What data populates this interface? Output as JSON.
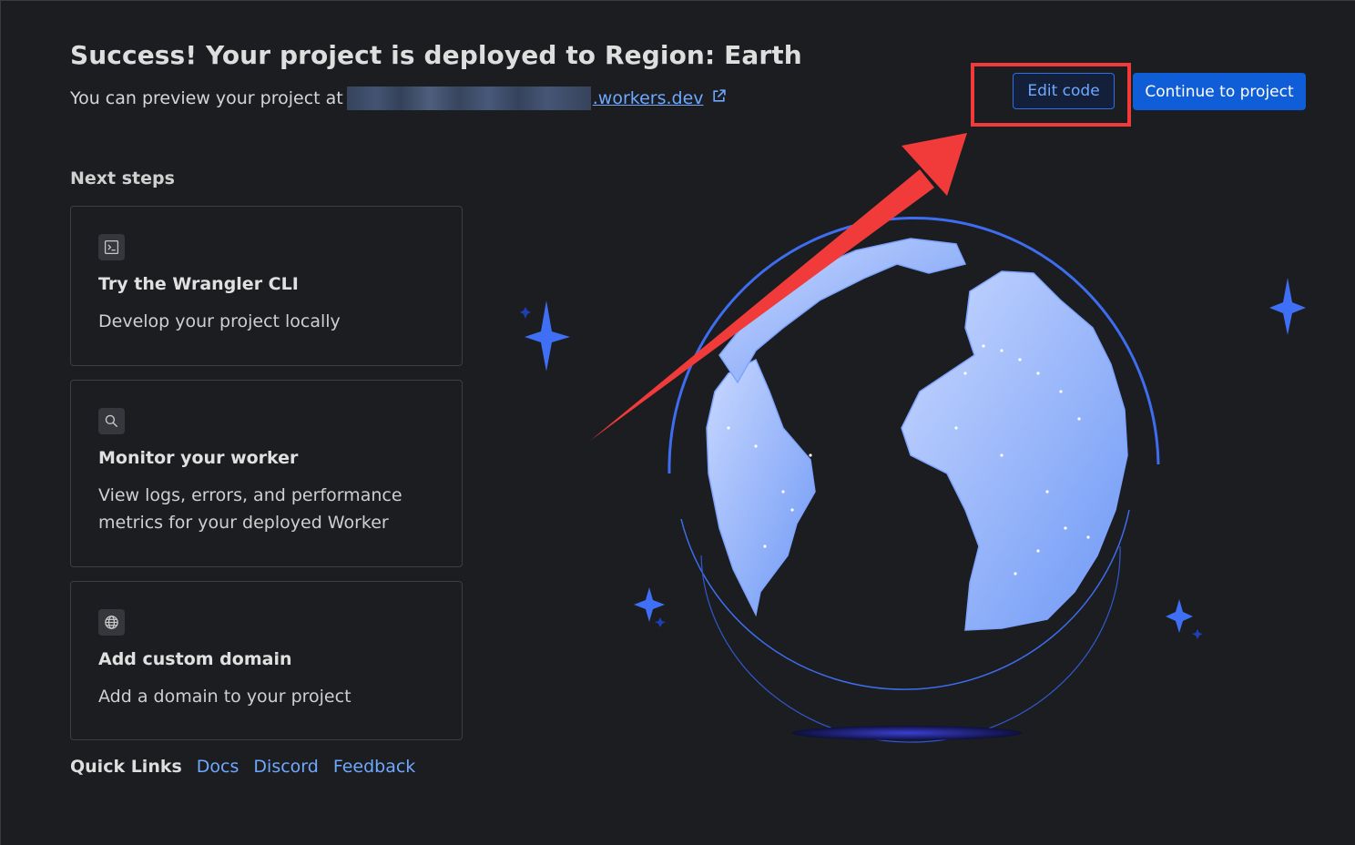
{
  "header": {
    "title": "Success! Your project is deployed to Region: Earth",
    "preview_prefix": "You can preview your project at",
    "preview_link_suffix": ".workers.dev",
    "external_link_icon": "external-link-icon"
  },
  "actions": {
    "edit_code": "Edit code",
    "continue": "Continue to project"
  },
  "next_steps": {
    "heading": "Next steps",
    "cards": [
      {
        "icon": "terminal-icon",
        "title": "Try the Wrangler CLI",
        "description": "Develop your project locally"
      },
      {
        "icon": "search-icon",
        "title": "Monitor your worker",
        "description": "View logs, errors, and performance metrics for your deployed Worker"
      },
      {
        "icon": "globe-icon",
        "title": "Add custom domain",
        "description": "Add a domain to your project"
      }
    ]
  },
  "quick_links": {
    "label": "Quick Links",
    "links": [
      "Docs",
      "Discord",
      "Feedback"
    ]
  },
  "colors": {
    "background": "#1c1d20",
    "accent": "#0f5ed8",
    "link": "#6ea8ff",
    "annotation": "#f13a3a"
  }
}
